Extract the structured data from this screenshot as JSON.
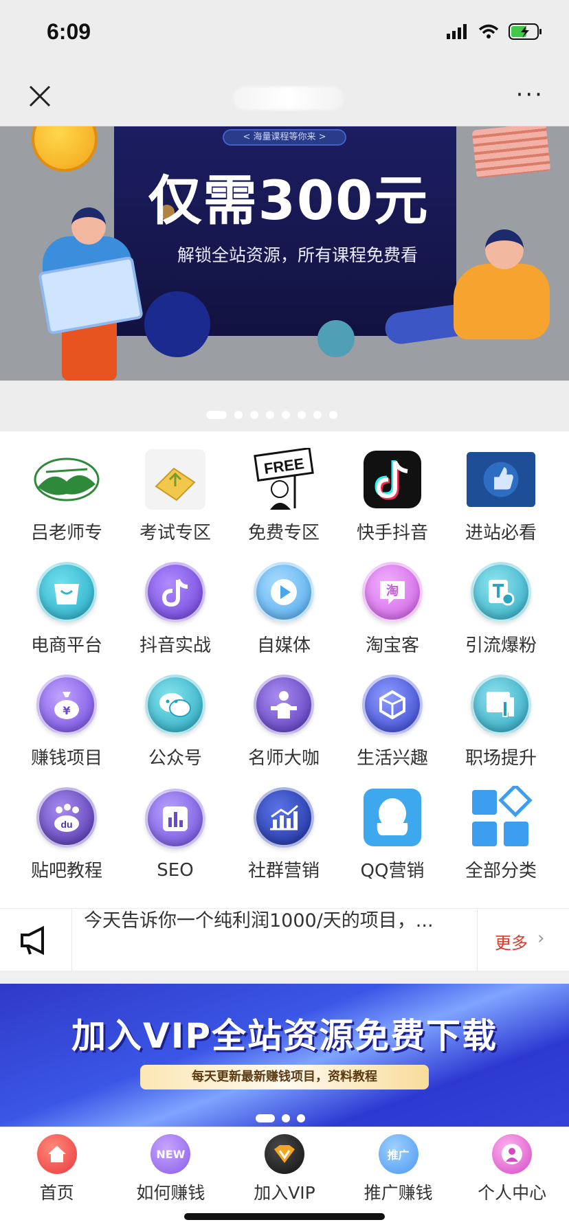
{
  "status": {
    "time": "6:09"
  },
  "nav": {
    "close_icon": "close-icon",
    "more_label": "···"
  },
  "banner": {
    "pill": "< 海量课程等你来 >",
    "title": "仅需300元",
    "subtitle": "解锁全站资源，所有课程免费看",
    "slide_count": 8,
    "active_slide": 0
  },
  "categories": [
    {
      "label": "吕老师专",
      "icon": "mountain-logo-icon",
      "color": "#2e8a3a"
    },
    {
      "label": "考试专区",
      "icon": "exam-scroll-icon",
      "color": "#f2c84b"
    },
    {
      "label": "免费专区",
      "icon": "free-sign-icon",
      "color": "#111111"
    },
    {
      "label": "快手抖音",
      "icon": "tiktok-icon",
      "color": "#111111"
    },
    {
      "label": "进站必看",
      "icon": "thumbs-up-icon",
      "color": "#1e5aa8"
    },
    {
      "label": "电商平台",
      "icon": "shopping-bag-icon",
      "color": "#2fb6cf"
    },
    {
      "label": "抖音实战",
      "icon": "tiktok-round-icon",
      "color": "#7a4ce0"
    },
    {
      "label": "自媒体",
      "icon": "play-video-icon",
      "color": "#59b4f0"
    },
    {
      "label": "淘宝客",
      "icon": "taobao-icon",
      "color": "#d46ee6"
    },
    {
      "label": "引流爆粉",
      "icon": "search-doc-icon",
      "color": "#3ab2c9"
    },
    {
      "label": "赚钱项目",
      "icon": "money-bag-icon",
      "color": "#7f57e6"
    },
    {
      "label": "公众号",
      "icon": "wechat-icon",
      "color": "#33b6c7"
    },
    {
      "label": "名师大咖",
      "icon": "teacher-podium-icon",
      "color": "#6a45c9"
    },
    {
      "label": "生活兴趣",
      "icon": "cubes-icon",
      "color": "#4a55d8"
    },
    {
      "label": "职场提升",
      "icon": "dashboard-icon",
      "color": "#35b3c9"
    },
    {
      "label": "贴吧教程",
      "icon": "baidu-paw-icon",
      "color": "#6a43c7"
    },
    {
      "label": "SEO",
      "icon": "bar-chart-icon",
      "color": "#7b58d8"
    },
    {
      "label": "社群营销",
      "icon": "growth-chart-icon",
      "color": "#2b44b8"
    },
    {
      "label": "QQ营销",
      "icon": "qq-penguin-icon",
      "color": "#3da8ee"
    },
    {
      "label": "全部分类",
      "icon": "all-categories-icon",
      "color": "#3d9ef0"
    }
  ],
  "notice": {
    "text": "今天告诉你一个纯利润1000/天的项目，...",
    "more_label": "更多",
    "chevron": "›"
  },
  "vip_banner": {
    "title": "加入VIP全站资源免费下载",
    "pill": "每天更新最新赚钱项目，资料教程"
  },
  "tabs": [
    {
      "label": "首页",
      "icon": "home-icon",
      "badge": "",
      "color": "#ef4b4b"
    },
    {
      "label": "如何赚钱",
      "icon": "new-badge-icon",
      "badge": "NEW",
      "color": "#9b6bf0"
    },
    {
      "label": "加入VIP",
      "icon": "vip-crown-icon",
      "badge": "",
      "color": "#2b2b2b"
    },
    {
      "label": "推广赚钱",
      "icon": "promote-icon",
      "badge": "推广",
      "color": "#55a8ff"
    },
    {
      "label": "个人中心",
      "icon": "user-icon",
      "badge": "",
      "color": "#e05bd0"
    }
  ]
}
